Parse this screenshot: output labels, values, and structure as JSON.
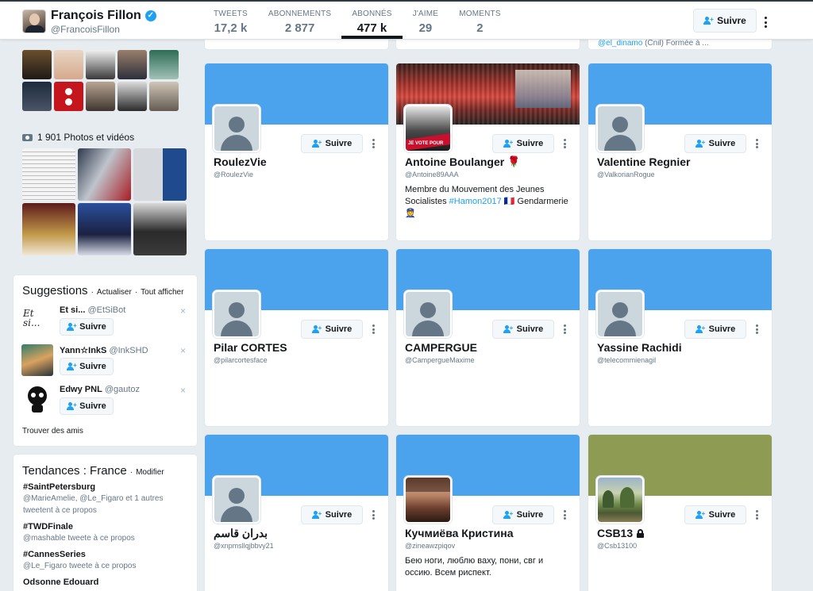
{
  "profile": {
    "name": "François Fillon",
    "handle": "@FrancoisFillon",
    "verified": true
  },
  "nav": [
    {
      "label": "TWEETS",
      "value": "17,2 k"
    },
    {
      "label": "ABONNEMENTS",
      "value": "2 877"
    },
    {
      "label": "ABONNÉS",
      "value": "477 k",
      "active": true
    },
    {
      "label": "J'AIME",
      "value": "29"
    },
    {
      "label": "MOMENTS",
      "value": "2"
    }
  ],
  "follow_label": "Suivre",
  "top_peek_text": {
    "handle": "@el_dinamo",
    "rest": " (Cnil) Formée à ..."
  },
  "photos": {
    "header": "1 901 Photos et vidéos"
  },
  "suggestions": {
    "title": "Suggestions",
    "refresh": "Actualiser",
    "show_all": "Tout afficher",
    "separator": "·",
    "items": [
      {
        "name": "Et si...",
        "handle": "@EtSiBot",
        "avatar_text": "Et si..."
      },
      {
        "name": "Yann☆InkS",
        "handle": "@InkSHD"
      },
      {
        "name": "Edwy PNL",
        "handle": "@gautoz"
      }
    ],
    "find_friends": "Trouver des amis",
    "close_glyph": "×"
  },
  "trends": {
    "title": "Tendances : France",
    "modify": "Modifier",
    "items": [
      {
        "tag": "#SaintPetersburg",
        "meta_handles": "@MarieAmelie, @Le_Figaro",
        "meta_rest": " et 1 autres tweetent à ce propos"
      },
      {
        "tag": "#TWDFinale",
        "meta_handles": "@mashable",
        "meta_rest": " tweete à ce propos"
      },
      {
        "tag": "#CannesSeries",
        "meta_handles": "@Le_Figaro",
        "meta_rest": " tweete à ce propos"
      },
      {
        "tag": "Odsonne Edouard",
        "meta_handles": "",
        "meta_rest": ""
      }
    ]
  },
  "cards": [
    {
      "name": "RoulezVie",
      "handle": "@RoulezVie",
      "bio": ""
    },
    {
      "name": "Antoine Boulanger",
      "handle": "@Antoine89AAA",
      "name_emoji": "🌹",
      "bio_prefix": "Membre du Mouvement des Jeunes Socialistes ",
      "bio_hashtag": "#Hamon2017",
      "bio_suffix": " 🇫🇷 Gendarmerie 👮",
      "avatar_caption": "JE VOTE POUR"
    },
    {
      "name": "Valentine Regnier",
      "handle": "@ValkorianRogue",
      "bio": ""
    },
    {
      "name": "Pilar CORTES",
      "handle": "@pilarcortesface",
      "bio": ""
    },
    {
      "name": "CAMPERGUE",
      "handle": "@CampergueMaxime",
      "bio": ""
    },
    {
      "name": "Yassine Rachidi",
      "handle": "@telecommienagil",
      "bio": ""
    },
    {
      "name": "بدران قاسم",
      "handle": "@xnpmsllqjbbvy21",
      "bio": ""
    },
    {
      "name": "Кучмиёва Кристина",
      "handle": "@zineawzpiqov",
      "bio": "Бею ноги, люблю ваху, пони, свг и оссию. Всем риспект."
    },
    {
      "name": "CSB13",
      "handle": "@Csb13100",
      "bio": "",
      "protected": true
    }
  ],
  "colors": {
    "accent": "#1da1f2",
    "banner_blue": "#4aa3ec",
    "banner_olive": "#8d9c52",
    "background": "#e6ecf0"
  }
}
